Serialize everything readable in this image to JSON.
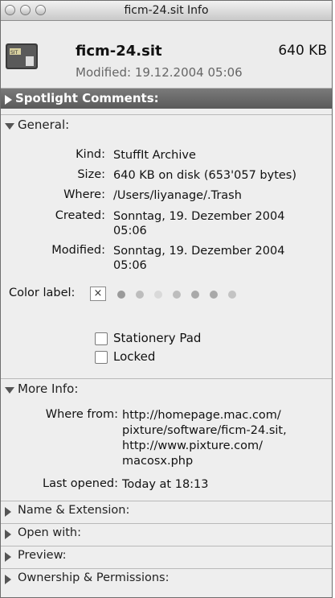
{
  "window": {
    "title": "ficm-24.sit Info"
  },
  "file": {
    "icon_label": "SIT",
    "name": "ficm-24.sit",
    "size": "640 KB",
    "modified": "Modified: 19.12.2004 05:06"
  },
  "spotlight": {
    "label": "Spotlight Comments:"
  },
  "general": {
    "label": "General:",
    "kind_label": "Kind:",
    "kind": "StuffIt Archive",
    "size_label": "Size:",
    "size": "640 KB on disk (653'057 bytes)",
    "where_label": "Where:",
    "where": "/Users/liyanage/.Trash",
    "created_label": "Created:",
    "created_l1": "Sonntag, 19. Dezember 2004",
    "created_l2": "05:06",
    "modified_label": "Modified:",
    "modified_l1": "Sonntag, 19. Dezember 2004",
    "modified_l2": "05:06",
    "color_label": "Color label:",
    "color_none": "×",
    "stationery": "Stationery Pad",
    "locked": "Locked"
  },
  "more_info": {
    "label": "More Info:",
    "where_from_label": "Where from:",
    "where_from_l1": "http://homepage.mac.com/",
    "where_from_l2": "pixture/software/ficm-24.sit,",
    "where_from_l3": "http://www.pixture.com/",
    "where_from_l4": "macosx.php",
    "last_opened_label": "Last opened:",
    "last_opened": "Today at 18:13"
  },
  "sections": {
    "name_ext": "Name & Extension:",
    "open_with": "Open with:",
    "preview": "Preview:",
    "ownership": "Ownership & Permissions:"
  }
}
